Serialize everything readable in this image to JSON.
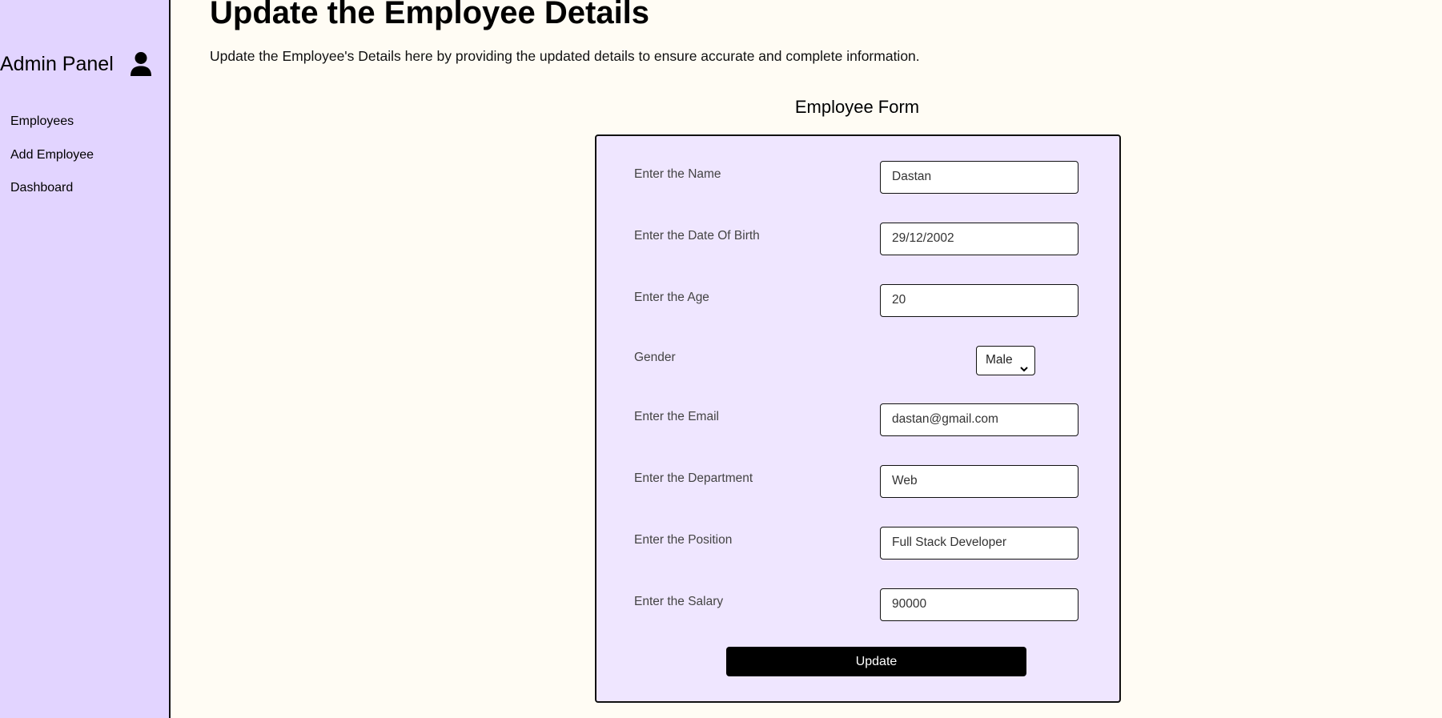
{
  "sidebar": {
    "brand_title": "Admin Panel",
    "brand_icon": "user-icon",
    "items": [
      {
        "label": "Employees"
      },
      {
        "label": "Add Employee"
      },
      {
        "label": "Dashboard"
      }
    ]
  },
  "header": {
    "title": "Update the Employee Details",
    "subtitle": "Update the Employee's Details here by providing the updated details to ensure accurate and complete information."
  },
  "form": {
    "title": "Employee Form",
    "fields": [
      {
        "label": "Enter the Name",
        "value": "Dastan"
      },
      {
        "label": "Enter the Date Of Birth",
        "value": "29/12/2002"
      },
      {
        "label": "Enter the Age",
        "value": "20"
      },
      {
        "label": "Gender",
        "value": "Male"
      },
      {
        "label": "Enter the Email",
        "value": "dastan@gmail.com"
      },
      {
        "label": "Enter the Department",
        "value": "Web"
      },
      {
        "label": "Enter the Position",
        "value": "Full Stack Developer"
      },
      {
        "label": "Enter the Salary",
        "value": "90000"
      }
    ],
    "submit_label": "Update"
  },
  "colors": {
    "sidebar_bg": "#e2d4ff",
    "page_bg": "#fffcf4",
    "card_bg": "#efe6ff",
    "button_bg": "#000000"
  }
}
